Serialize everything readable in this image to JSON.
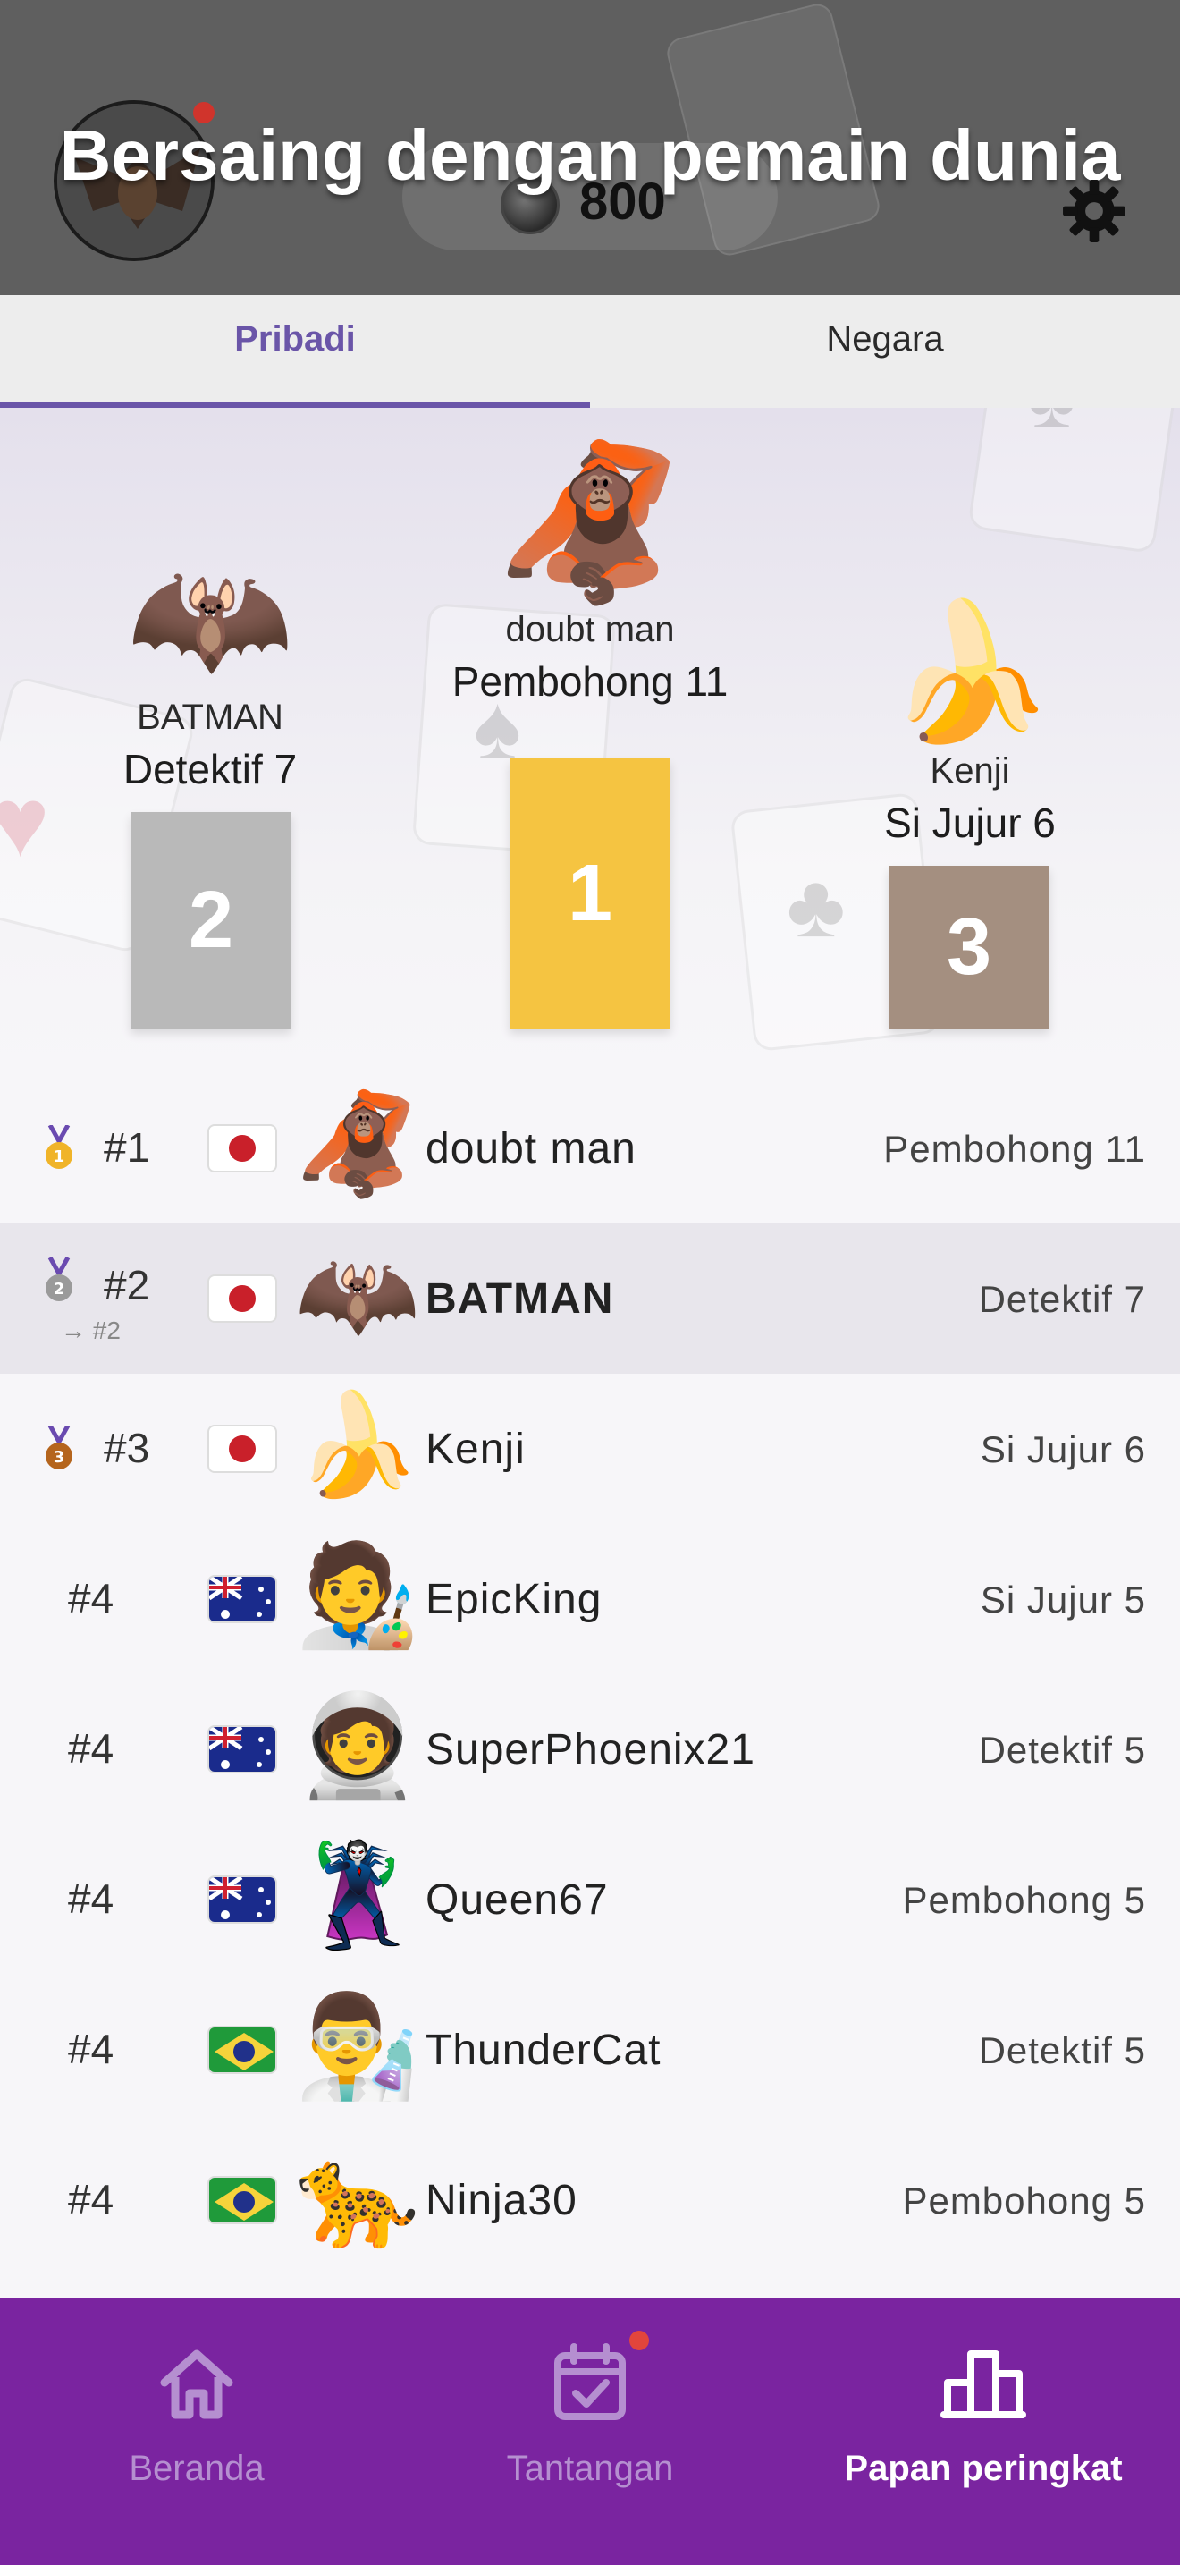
{
  "header": {
    "title": "Bersaing dengan pemain dunia",
    "coins": "800",
    "avatar_icon": "bat-avatar",
    "settings_icon": "gear-icon"
  },
  "tabs": [
    {
      "label": "Pribadi",
      "active": true
    },
    {
      "label": "Negara",
      "active": false
    }
  ],
  "podium": {
    "first": {
      "emoji": "🦧",
      "name": "doubt man",
      "rank": "Pembohong 11",
      "place": "1",
      "color": "#f5c441"
    },
    "second": {
      "emoji": "🦇",
      "name": "BATMAN",
      "rank": "Detektif 7",
      "place": "2",
      "color": "#b9b9b9"
    },
    "third": {
      "emoji": "🍌",
      "name": "Kenji",
      "rank": "Si Jujur 6",
      "place": "3",
      "color": "#a48f80"
    }
  },
  "leaderboard": [
    {
      "position": "#1",
      "medal": "gold",
      "flag": "JP",
      "emoji": "🦧",
      "name": "doubt man",
      "rank": "Pembohong 11",
      "me": false
    },
    {
      "position": "#2",
      "medal": "silver",
      "flag": "JP",
      "emoji": "🦇",
      "name": "BATMAN",
      "rank": "Detektif 7",
      "me": true,
      "sub": "→ #2"
    },
    {
      "position": "#3",
      "medal": "bronze",
      "flag": "JP",
      "emoji": "🍌",
      "name": "Kenji",
      "rank": "Si Jujur 6",
      "me": false
    },
    {
      "position": "#4",
      "medal": "",
      "flag": "AU",
      "emoji": "🧑‍🎨",
      "name": "EpicKing",
      "rank": "Si Jujur 5",
      "me": false
    },
    {
      "position": "#4",
      "medal": "",
      "flag": "AU",
      "emoji": "🧑‍🚀",
      "name": "SuperPhoenix21",
      "rank": "Detektif 5",
      "me": false
    },
    {
      "position": "#4",
      "medal": "",
      "flag": "AU",
      "emoji": "🦹",
      "name": "Queen67",
      "rank": "Pembohong 5",
      "me": false
    },
    {
      "position": "#4",
      "medal": "",
      "flag": "BR",
      "emoji": "👨‍🔬",
      "name": "ThunderCat",
      "rank": "Detektif 5",
      "me": false
    },
    {
      "position": "#4",
      "medal": "",
      "flag": "BR",
      "emoji": "🐆",
      "name": "Ninja30",
      "rank": "Pembohong 5",
      "me": false
    }
  ],
  "nav": [
    {
      "label": "Beranda",
      "icon": "home-icon",
      "active": false,
      "badge": false
    },
    {
      "label": "Tantangan",
      "icon": "calendar-check-icon",
      "active": false,
      "badge": true
    },
    {
      "label": "Papan peringkat",
      "icon": "leaderboard-icon",
      "active": true,
      "badge": false
    }
  ],
  "colors": {
    "accent": "#6a55a8",
    "nav_bg": "#7a24a0",
    "notification": "#e2453c"
  }
}
